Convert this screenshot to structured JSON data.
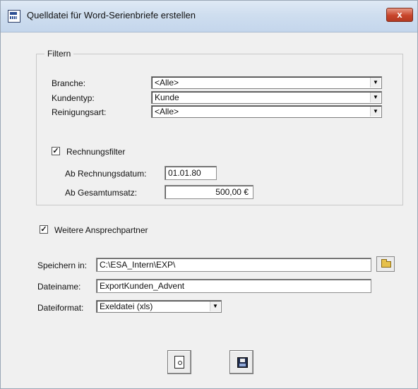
{
  "window": {
    "title": "Quelldatei für Word-Serienbriefe erstellen",
    "close_label": "x"
  },
  "filter": {
    "legend": "Filtern",
    "branche": {
      "label": "Branche:",
      "value": "<Alle>"
    },
    "kundentyp": {
      "label": "Kundentyp:",
      "value": "Kunde"
    },
    "reinigungsart": {
      "label": "Reinigungsart:",
      "value": "<Alle>"
    },
    "rechnungsfilter": {
      "label": "Rechnungsfilter",
      "checked": true,
      "mark": "✓"
    },
    "ab_rechnungsdatum": {
      "label": "Ab Rechnungsdatum:",
      "value": "01.01.80"
    },
    "ab_gesamtumsatz": {
      "label": "Ab Gesamtumsatz:",
      "value": "500,00 €"
    }
  },
  "weitere": {
    "label": "Weitere Ansprechpartner",
    "checked": true,
    "mark": "✓"
  },
  "speichern": {
    "label": "Speichern in:",
    "value": "C:\\ESA_Intern\\EXP\\"
  },
  "dateiname": {
    "label": "Dateiname:",
    "value": "ExportKunden_Advent"
  },
  "dateiformat": {
    "label": "Dateiformat:",
    "value": "Exeldatei (xls)"
  },
  "icons": {
    "app": "form-icon",
    "folder": "folder-open-icon",
    "preview": "print-preview-icon",
    "save": "save-disk-icon",
    "dropdown": "chevron-down-icon"
  }
}
